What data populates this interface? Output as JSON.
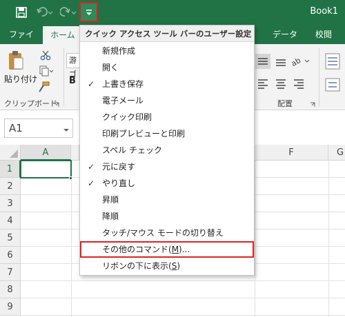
{
  "title_bar": {
    "book_title": "Book1"
  },
  "tabs": {
    "file": "ファイル",
    "home": "ホーム",
    "data": "データ",
    "review": "校閲"
  },
  "ribbon": {
    "paste_label": "貼り付け",
    "clipboard_label": "クリップボード",
    "font_name_partial": "游ゴ",
    "bold": "B",
    "alignment_label": "配置"
  },
  "name_box": {
    "value": "A1"
  },
  "columns": [
    "A",
    "F",
    "G"
  ],
  "rows": [
    "1",
    "2",
    "3",
    "4",
    "5",
    "6",
    "7",
    "8",
    "9"
  ],
  "menu": {
    "header": "クイック アクセス ツール バーのユーザー設定",
    "items": [
      {
        "label": "新規作成",
        "checked": false
      },
      {
        "label": "開く",
        "checked": false
      },
      {
        "label": "上書き保存",
        "checked": true
      },
      {
        "label": "電子メール",
        "checked": false
      },
      {
        "label": "クイック印刷",
        "checked": false
      },
      {
        "label": "印刷プレビューと印刷",
        "checked": false
      },
      {
        "label": "スペル チェック",
        "checked": false
      },
      {
        "label": "元に戻す",
        "checked": true
      },
      {
        "label": "やり直し",
        "checked": true
      },
      {
        "label": "昇順",
        "checked": false
      },
      {
        "label": "降順",
        "checked": false
      },
      {
        "label": "タッチ/マウス モードの切り替え",
        "checked": false
      }
    ],
    "more_commands": {
      "prefix": "その他のコマンド(",
      "key": "M",
      "suffix": ")..."
    },
    "below_ribbon": {
      "prefix": "リボンの下に表示(",
      "key": "S",
      "suffix": ")"
    },
    "check_mark": "✓"
  },
  "colors": {
    "excel_green": "#217346",
    "highlight_red": "#e02020"
  }
}
